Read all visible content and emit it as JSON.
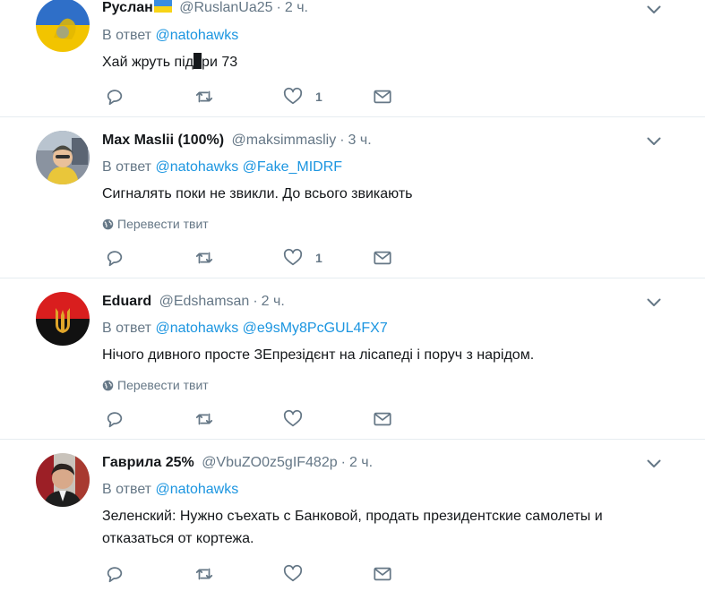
{
  "labels": {
    "reply_prefix": "В ответ",
    "translate": "Перевести твит"
  },
  "colors": {
    "link": "#1b95e0",
    "muted": "#657786",
    "text": "#14171a",
    "divider": "#e6ecf0"
  },
  "tweets": [
    {
      "name": "Руслан",
      "handle": "@RuslanUa25",
      "time": "2 ч.",
      "reply_to": [
        "@natohawks"
      ],
      "text_a": "Хай  жруть під",
      "text_b": "ри 73",
      "like_count": "1",
      "avatar": "ukraine-flag-avatar"
    },
    {
      "name": "Max Maslii (100%)",
      "handle": "@maksimmasliy",
      "time": "3 ч.",
      "reply_to": [
        "@natohawks",
        "@Fake_MIDRF"
      ],
      "text": "Сигналять поки не звикли. До всього звикають",
      "like_count": "1",
      "avatar": "child-photo-avatar"
    },
    {
      "name": "Eduard",
      "handle": "@Edshamsan",
      "time": "2 ч.",
      "reply_to": [
        "@natohawks",
        "@e9sMy8PcGUL4FX7"
      ],
      "text": "Нічого дивного просте ЗЕпрезідєнт на лісапеді і поруч з нарідом.",
      "avatar": "red-black-trident-avatar"
    },
    {
      "name": "Гаврила 25%",
      "handle": "@VbuZO0z5gIF482p",
      "time": "2 ч.",
      "reply_to": [
        "@natohawks"
      ],
      "text": "Зеленский: Нужно съехать с Банковой, продать президентские самолеты и отказаться от кортежа.",
      "avatar": "man-photo-avatar"
    }
  ]
}
